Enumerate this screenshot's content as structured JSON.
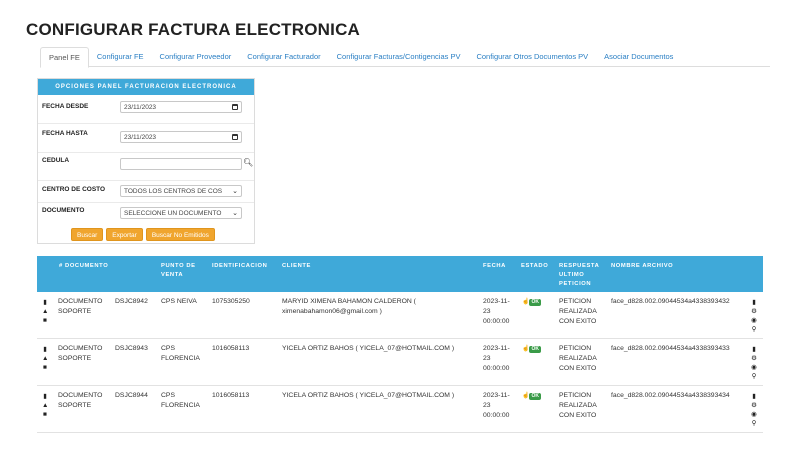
{
  "page_title": "CONFIGURAR FACTURA ELECTRONICA",
  "tabs": [
    {
      "label": "Panel FE",
      "active": true
    },
    {
      "label": "Configurar FE",
      "active": false
    },
    {
      "label": "Configurar Proveedor",
      "active": false
    },
    {
      "label": "Configurar Facturador",
      "active": false
    },
    {
      "label": "Configurar Facturas/Contigencias PV",
      "active": false
    },
    {
      "label": "Configurar Otros Documentos PV",
      "active": false
    },
    {
      "label": "Asociar Documentos",
      "active": false
    }
  ],
  "panel": {
    "title": "OPCIONES PANEL FACTURACION ELECTRONICA",
    "fields": {
      "fecha_desde": {
        "label": "FECHA DESDE",
        "value": "23/11/2023"
      },
      "fecha_hasta": {
        "label": "FECHA HASTA",
        "value": "23/11/2023"
      },
      "cedula": {
        "label": "CEDULA",
        "value": ""
      },
      "centro_costo": {
        "label": "CENTRO DE COSTO",
        "value": "TODOS LOS CENTROS DE COS"
      },
      "documento": {
        "label": "DOCUMENTO",
        "value": "SELECCIONE UN DOCUMENTO"
      }
    },
    "buttons": {
      "buscar": "Buscar",
      "exportar": "Exportar",
      "buscar_no_emitidos": "Buscar No Emitidos"
    }
  },
  "table": {
    "headers": {
      "documento": "# DOCUMENTO",
      "punto_venta": "PUNTO DE VENTA",
      "identificacion": "IDENTIFICACION",
      "cliente": "CLIENTE",
      "fecha": "FECHA",
      "estado": "ESTADO",
      "respuesta": "RESPUESTA ULTIMO PETICION",
      "archivo": "NOMBRE ARCHIVO"
    },
    "rows": [
      {
        "tipo": "DOCUMENTO SOPORTE",
        "numero": "DSJC8942",
        "punto_venta": "CPS NEIVA",
        "identificacion": "1075305250",
        "cliente": "MARYID XIMENA BAHAMON CALDERON ( ximenabahamon06@gmail.com )",
        "fecha": "2023-11-23 00:00:00",
        "estado": "OK",
        "respuesta": "PETICION REALIZADA CON EXITO",
        "archivo": "face_d828.002.09044534a4338393432"
      },
      {
        "tipo": "DOCUMENTO SOPORTE",
        "numero": "DSJC8943",
        "punto_venta": "CPS FLORENCIA",
        "identificacion": "1016058113",
        "cliente": "YICELA ORTIZ BAHOS ( YICELA_07@HOTMAIL.COM )",
        "fecha": "2023-11-23 00:00:00",
        "estado": "OK",
        "respuesta": "PETICION REALIZADA CON EXITO",
        "archivo": "face_d828.002.09044534a4338393433"
      },
      {
        "tipo": "DOCUMENTO SOPORTE",
        "numero": "DSJC8944",
        "punto_venta": "CPS FLORENCIA",
        "identificacion": "1016058113",
        "cliente": "YICELA ORTIZ BAHOS ( YICELA_07@HOTMAIL.COM )",
        "fecha": "2023-11-23 00:00:00",
        "estado": "OK",
        "respuesta": "PETICION REALIZADA CON EXITO",
        "archivo": "face_d828.002.09044534a4338393434"
      }
    ]
  },
  "icons": {
    "left": [
      "bookmark-icon",
      "home-icon",
      "file-icon"
    ],
    "right": [
      "comment-icon",
      "gear-icon",
      "view-icon",
      "search-icon"
    ]
  },
  "colors": {
    "header_blue": "#3fa9d9",
    "button_orange": "#f0a52e",
    "ok_green": "#3a9b48",
    "link_blue": "#2a7fc4"
  }
}
